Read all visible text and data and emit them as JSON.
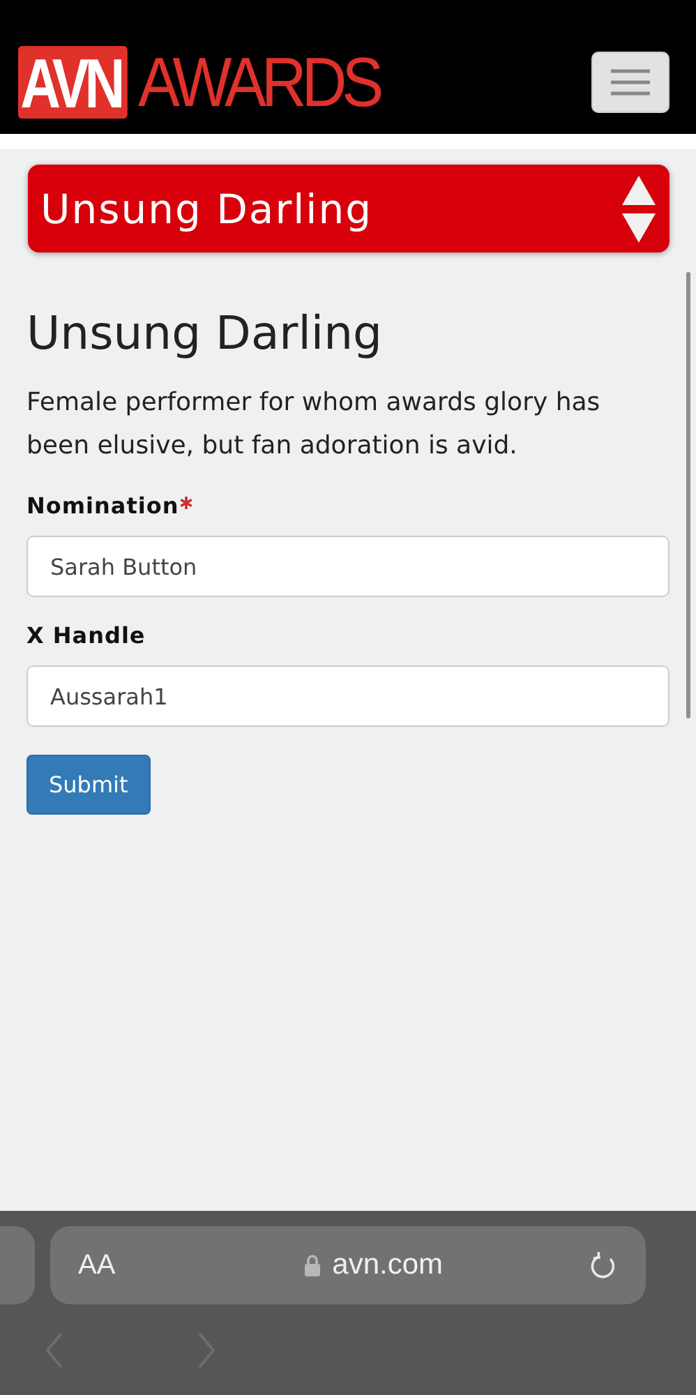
{
  "header": {
    "logo": {
      "part_1": "AVN",
      "part_2": "AWARDS"
    }
  },
  "category_select": {
    "value": "Unsung Darling"
  },
  "heading": "Unsung Darling",
  "description": "Female performer for whom awards glory has been elusive, but fan adoration is avid.",
  "fields": [
    {
      "label": "Nomination",
      "required": true,
      "value": "Sarah Button"
    },
    {
      "label": "X Handle",
      "required": false,
      "value": "Aussarah1"
    }
  ],
  "submit": "Submit",
  "browser_bar": {
    "text_size": "AA",
    "url": "avn.com",
    "back_disabled": true,
    "forward_disabled": true
  }
}
